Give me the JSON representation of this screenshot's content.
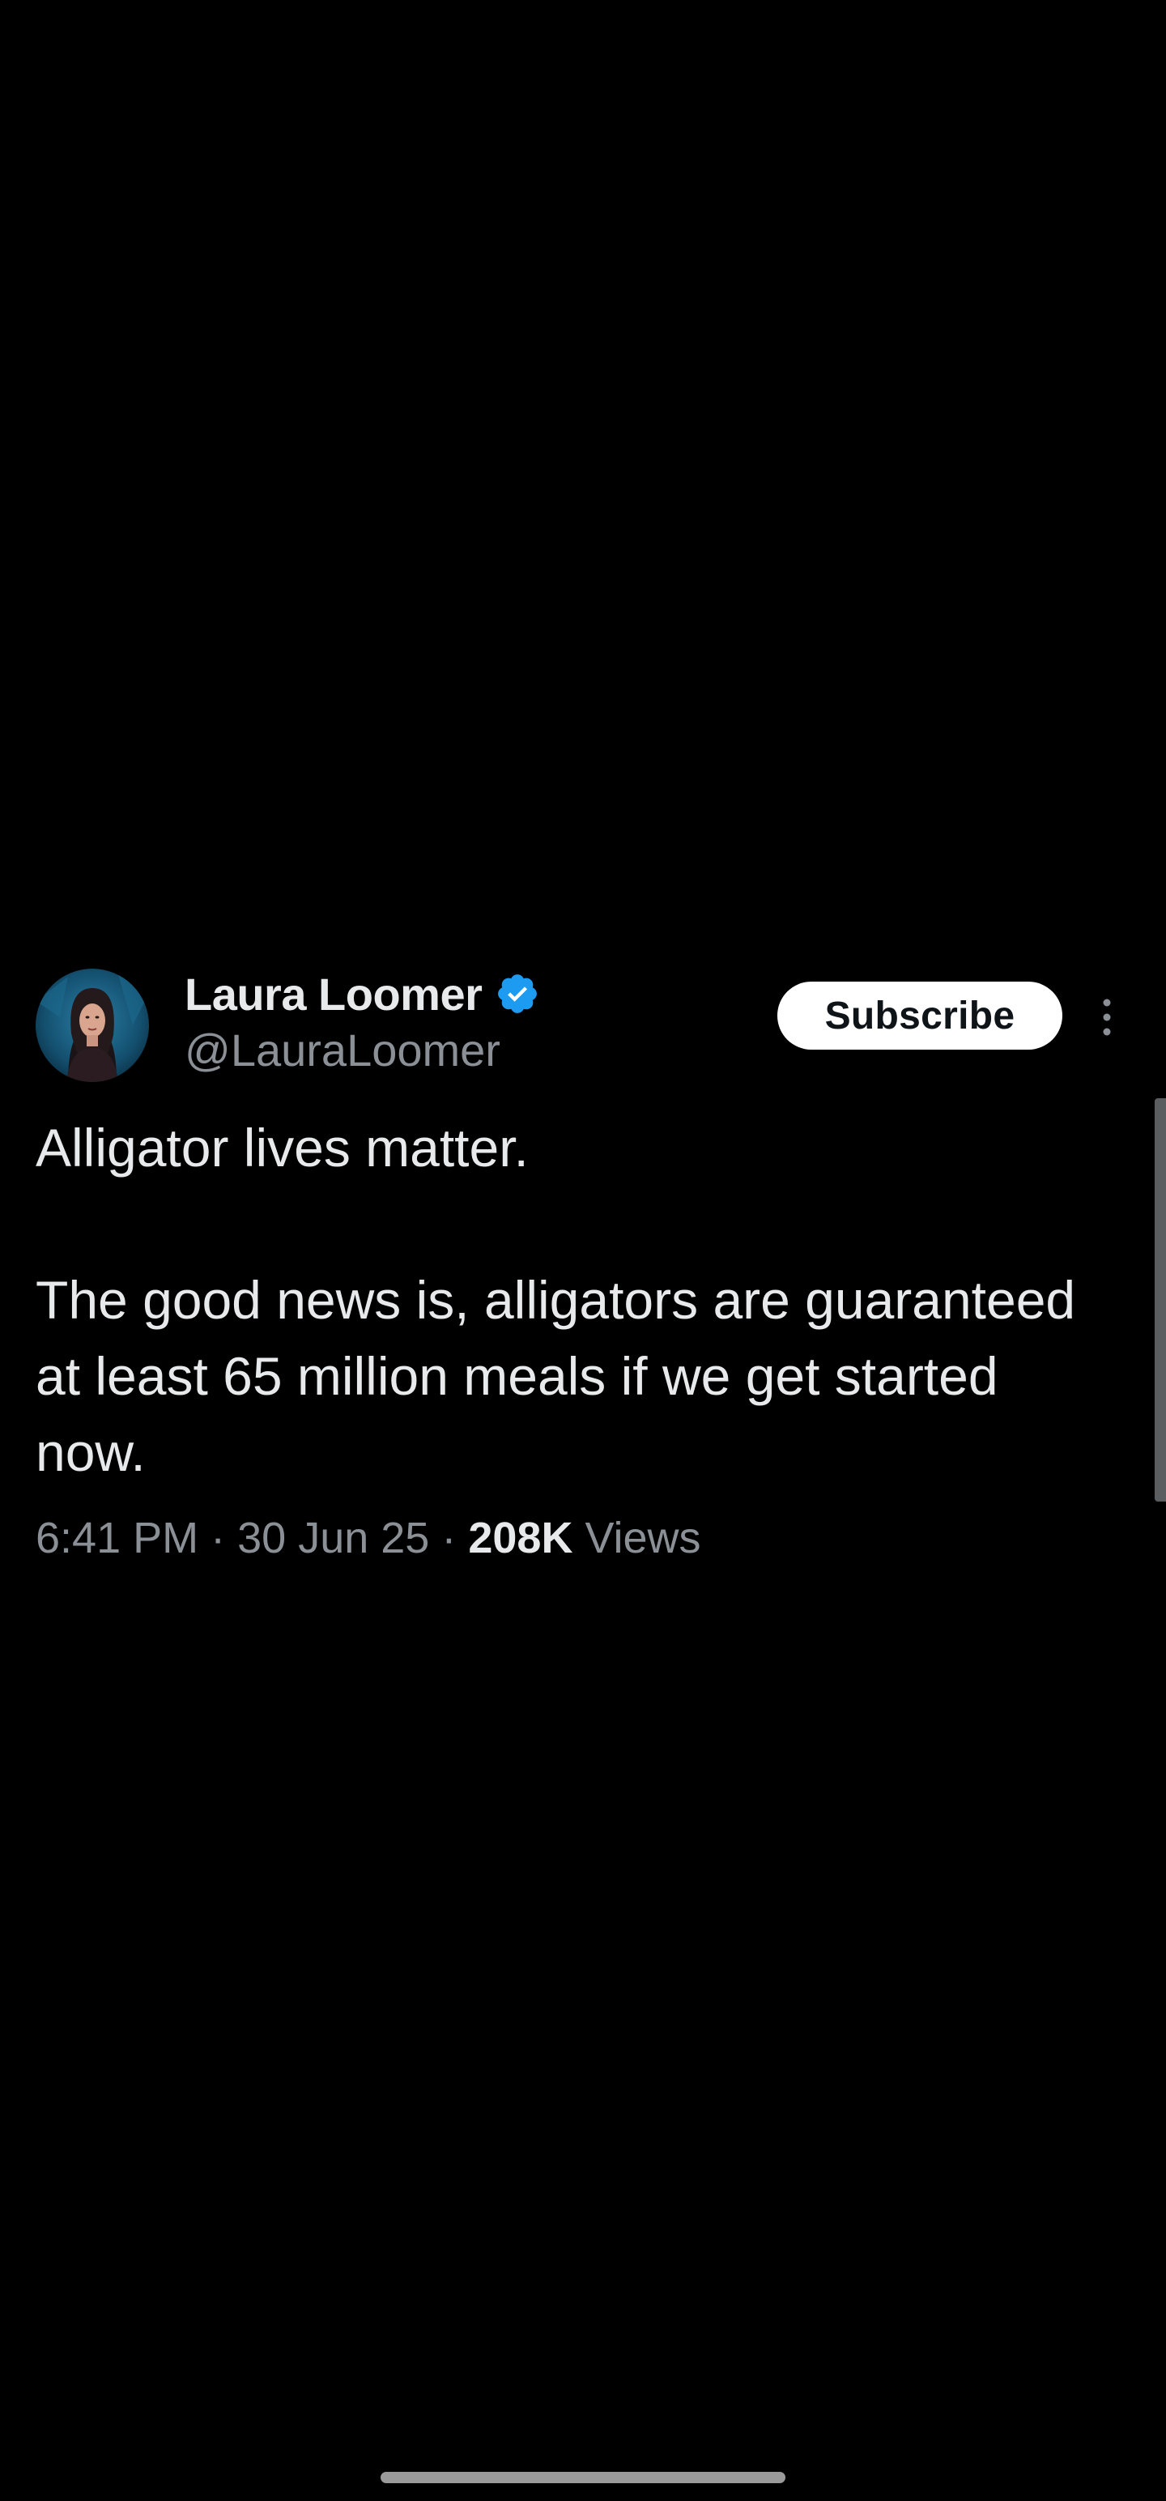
{
  "tweet": {
    "author": {
      "display_name": "Laura Loomer",
      "handle": "@LauraLoomer",
      "verified": true,
      "avatar_icon": "profile-photo-avatar"
    },
    "subscribe_label": "Subscribe",
    "body": {
      "line1": "Alligator lives matter.",
      "line2": "The good news is, alligators are guaranteed at least 65 million meals if we get started now."
    },
    "meta": {
      "time": "6:41 PM",
      "separator": "·",
      "date": "30 Jun 25",
      "views_count": "208K",
      "views_label": "Views"
    }
  },
  "icons": {
    "verified": "verified-badge-icon",
    "more": "more-options-icon"
  },
  "colors": {
    "background": "#000000",
    "text_primary": "#e7e9ea",
    "text_secondary": "#8b9096",
    "verified_blue": "#1d9bf0",
    "button_bg": "#ffffff"
  }
}
